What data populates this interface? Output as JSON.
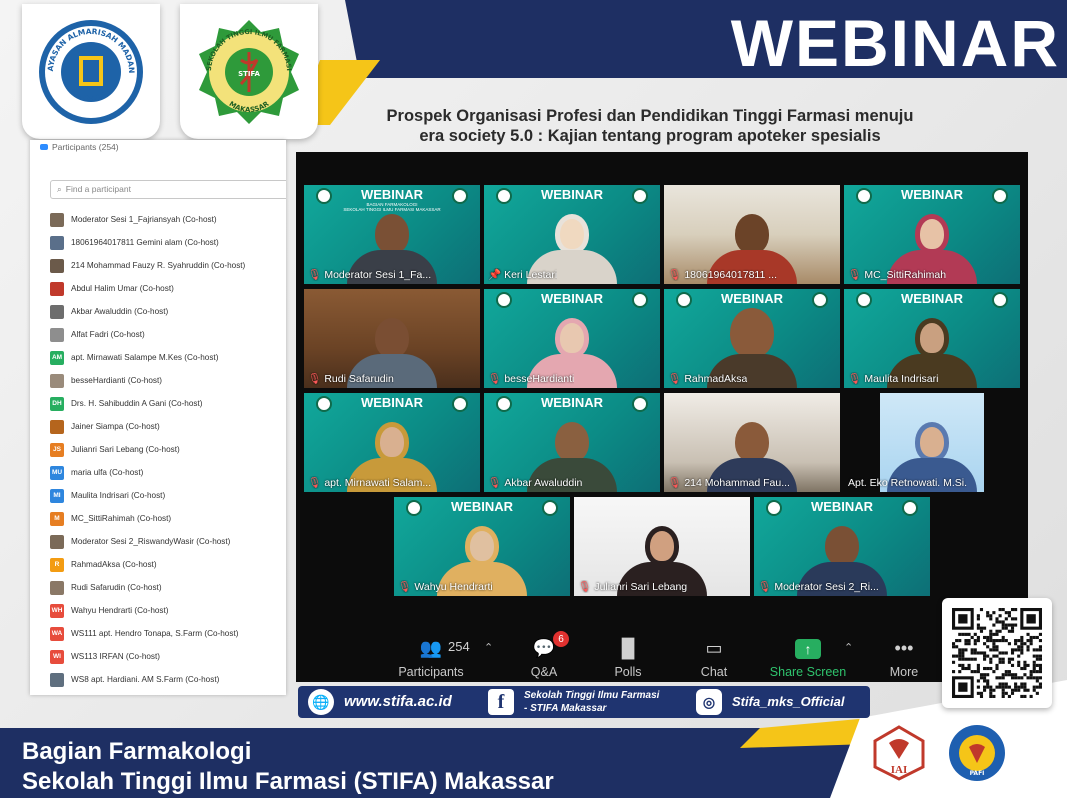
{
  "header": {
    "title": "WEBINAR",
    "subtitle_line1": "Prospek Organisasi Profesi dan Pendidikan Tinggi Farmasi menuju",
    "subtitle_line2": "era society 5.0 : Kajian tentang program apoteker spesialis"
  },
  "participants_panel": {
    "title": "Participants (254)",
    "search_placeholder": "Find a participant",
    "items": [
      {
        "label": "Moderator Sesi 1_Fajriansyah (Co-host)",
        "avatar": "",
        "color": "#7b6a58"
      },
      {
        "label": "18061964017811 Gemini alam (Co-host)",
        "avatar": "",
        "color": "#5a6f8a"
      },
      {
        "label": "214 Mohammad Fauzy R. Syahruddin (Co-host)",
        "avatar": "",
        "color": "#6b5a4a"
      },
      {
        "label": "Abdul Halim Umar (Co-host)",
        "avatar": "",
        "color": "#c0392b"
      },
      {
        "label": "Akbar Awaluddin (Co-host)",
        "avatar": "",
        "color": "#6d6d6d"
      },
      {
        "label": "Alfat Fadri (Co-host)",
        "avatar": "",
        "color": "#8e8e8e"
      },
      {
        "label": "apt. Mirnawati Salampe M.Kes (Co-host)",
        "avatar": "AM",
        "color": "#27ae60"
      },
      {
        "label": "besseHardianti (Co-host)",
        "avatar": "",
        "color": "#9a8b7b"
      },
      {
        "label": "Drs. H. Sahibuddin A Gani (Co-host)",
        "avatar": "DH",
        "color": "#27ae60"
      },
      {
        "label": "Jainer Siampa (Co-host)",
        "avatar": "",
        "color": "#b5651d"
      },
      {
        "label": "Julianri Sari Lebang (Co-host)",
        "avatar": "JS",
        "color": "#e67e22"
      },
      {
        "label": "maria ulfa (Co-host)",
        "avatar": "MU",
        "color": "#2e86de"
      },
      {
        "label": "Maulita Indrisari (Co-host)",
        "avatar": "MI",
        "color": "#2e86de"
      },
      {
        "label": "MC_SittiRahimah (Co-host)",
        "avatar": "M",
        "color": "#e67e22"
      },
      {
        "label": "Moderator Sesi 2_RiswandyWasir (Co-host)",
        "avatar": "",
        "color": "#7b6a58"
      },
      {
        "label": "RahmadAksa (Co-host)",
        "avatar": "R",
        "color": "#f39c12"
      },
      {
        "label": "Rudi Safarudin (Co-host)",
        "avatar": "",
        "color": "#8a7866"
      },
      {
        "label": "Wahyu Hendrarti (Co-host)",
        "avatar": "WH",
        "color": "#e74c3c"
      },
      {
        "label": "WS111 apt. Hendro Tonapa, S.Farm (Co-host)",
        "avatar": "WA",
        "color": "#e74c3c"
      },
      {
        "label": "WS113 IRFAN (Co-host)",
        "avatar": "WI",
        "color": "#e74c3c"
      },
      {
        "label": "WS8 apt. Hardiani. AM S.Farm (Co-host)",
        "avatar": "",
        "color": "#5f6f7f"
      }
    ]
  },
  "tiles": {
    "t1": "Moderator Sesi 1_Fa...",
    "t2": "Keri Lestari",
    "t3": "18061964017811 ...",
    "t4": "MC_SittiRahimah",
    "t5": "Rudi Safarudin",
    "t6": "besseHardianti",
    "t7": "RahmadAksa",
    "t8": "Maulita Indrisari",
    "t9": "apt. Mirnawati Salam...",
    "t10": "Akbar Awaluddin",
    "t11": "214 Mohammad Fau...",
    "t12": "Apt. Eko Retnowati. M.Si.",
    "t13": "Wahyu Hendrarti",
    "t14": "Julianri Sari Lebang",
    "t15": "Moderator Sesi 2_Ri..."
  },
  "banner_text": {
    "word": "WEBINAR",
    "line1": "BAGIAN FARMAKOLOGI",
    "line2": "SEKOLAH TINGGI ILMU FARMASI MAKASSAR"
  },
  "toolbar": {
    "participants_count": "254",
    "participants_label": "Participants",
    "qa_label": "Q&A",
    "qa_badge": "6",
    "polls_label": "Polls",
    "chat_label": "Chat",
    "share_label": "Share Screen",
    "more_label": "More"
  },
  "social": {
    "website": "www.stifa.ac.id",
    "facebook_line1": "Sekolah Tinggi Ilmu Farmasi",
    "facebook_line2": "- STIFA Makassar",
    "instagram": "Stifa_mks_Official"
  },
  "footer": {
    "line1": "Bagian Farmakologi",
    "line2": "Sekolah Tinggi Ilmu Farmasi (STIFA) Makassar"
  },
  "logos": {
    "logo1_text_top": "YAYASAN ALMARISAH MADANI",
    "logo1_text_bottom": "MAKASSAR",
    "logo2_text_top": "SEKOLAH TINGGI ILMU FARMASI",
    "logo2_text_mid": "STIFA",
    "logo2_text_bottom": "MAKASSAR",
    "iai_text": "IAI",
    "pafi_text": "PAFI"
  },
  "colors": {
    "navy": "#1e2f63",
    "yellow": "#f5c518",
    "teal": "#11a89b",
    "share_green": "#2fc36d"
  }
}
